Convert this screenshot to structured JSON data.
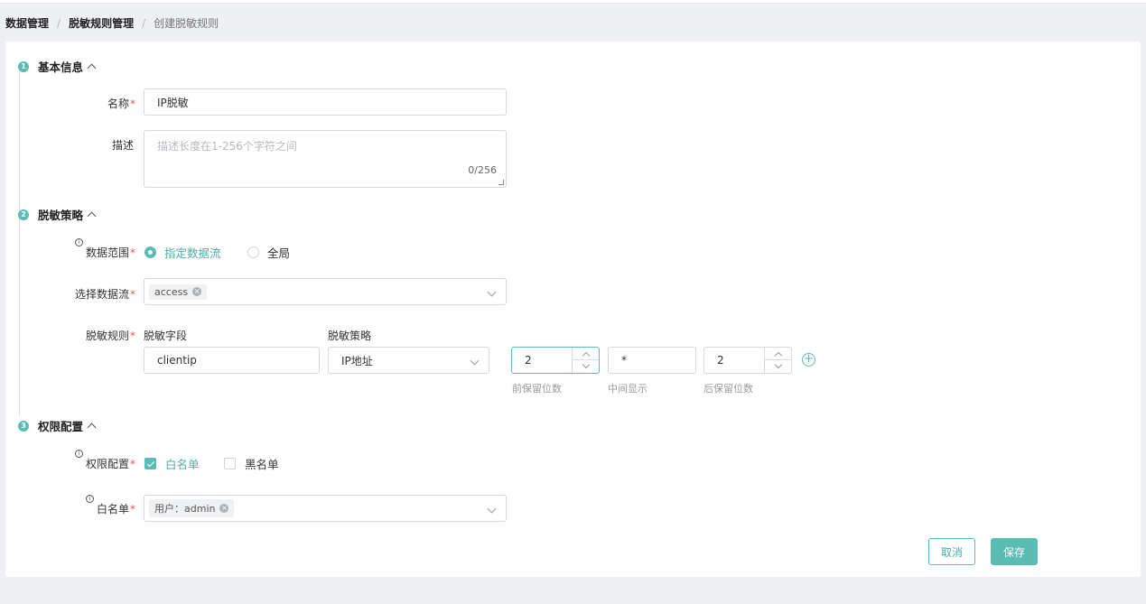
{
  "breadcrumb": {
    "items": [
      "数据管理",
      "脱敏规则管理"
    ],
    "separator": "/",
    "current": "创建脱敏规则"
  },
  "sections": {
    "basic": {
      "step": "1",
      "title": "基本信息"
    },
    "policy": {
      "step": "2",
      "title": "脱敏策略"
    },
    "permission": {
      "step": "3",
      "title": "权限配置"
    }
  },
  "basic": {
    "name_label": "名称",
    "name_value": "IP脱敏",
    "desc_label": "描述",
    "desc_placeholder": "描述长度在1-256个字符之间",
    "desc_count": "0/256"
  },
  "policy": {
    "scope_label": "数据范围",
    "scope_options": [
      "指定数据流",
      "全局"
    ],
    "scope_selected": "指定数据流",
    "stream_label": "选择数据流",
    "stream_tags": [
      "access"
    ],
    "rule_label": "脱敏规则",
    "field_header": "脱敏字段",
    "strategy_header": "脱敏策略",
    "field_value": "clientip",
    "strategy_value": "IP地址",
    "keep_front_value": "2",
    "keep_front_label": "前保留位数",
    "middle_value": "*",
    "middle_label": "中间显示",
    "keep_back_value": "2",
    "keep_back_label": "后保留位数"
  },
  "permission": {
    "config_label": "权限配置",
    "options": [
      "白名单",
      "黑名单"
    ],
    "checked": [
      "白名单"
    ],
    "whitelist_label": "白名单",
    "whitelist_tags": [
      "用户：admin"
    ]
  },
  "actions": {
    "cancel": "取消",
    "save": "保存"
  },
  "colors": {
    "accent": "#5bbcb4",
    "required": "#e55555"
  }
}
